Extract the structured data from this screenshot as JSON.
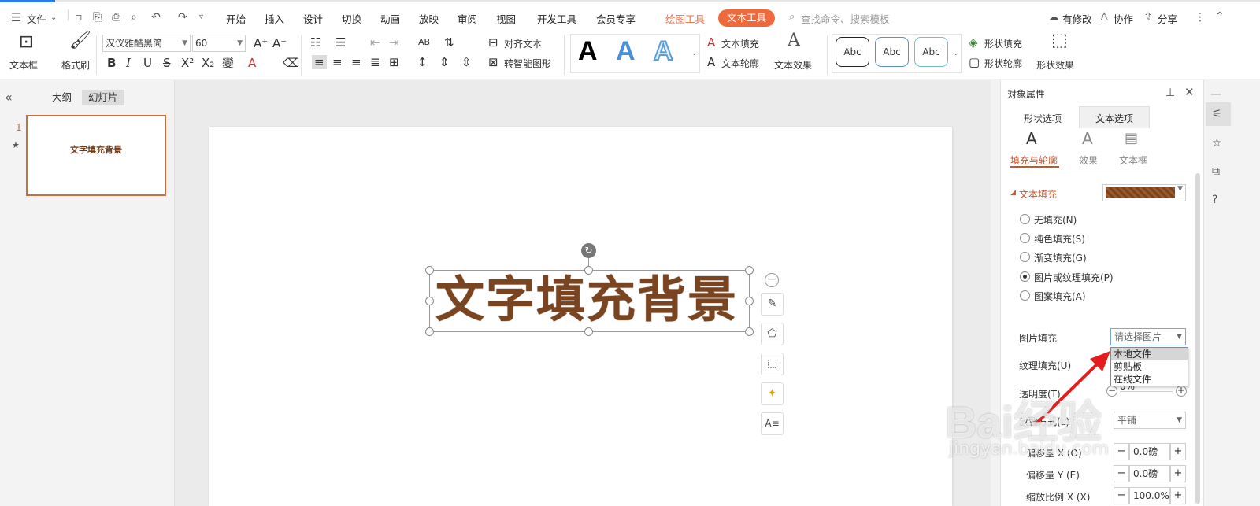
{
  "menubar": {
    "file": "文件",
    "tabs": [
      "开始",
      "插入",
      "设计",
      "切换",
      "动画",
      "放映",
      "审阅",
      "视图",
      "开发工具",
      "会员专享"
    ],
    "drawing_tools": "绘图工具",
    "text_tools": "文本工具",
    "search_placeholder": "查找命令、搜索模板",
    "has_changes": "有修改",
    "collaborate": "协作",
    "share": "分享"
  },
  "ribbon": {
    "textbox": "文本框",
    "format_painter": "格式刷",
    "font_name": "汉仪雅酷黑简",
    "font_size": "60",
    "align_text": "对齐文本",
    "smart_shape": "转智能图形",
    "text_fill": "文本填充",
    "text_outline": "文本轮廓",
    "text_effect": "文本效果",
    "style_sample": "Abc",
    "shape_fill": "形状填充",
    "shape_outline": "形状轮廓",
    "shape_effect": "形状效果",
    "bigA": "A"
  },
  "left_panel": {
    "outline_tab": "大纲",
    "slides_tab": "幻灯片",
    "slide_number": "1",
    "thumb_text": "文字填充背景"
  },
  "slide": {
    "main_text": "文字填充背景"
  },
  "right_panel": {
    "title": "对象属性",
    "tab_shape": "形状选项",
    "tab_text": "文本选项",
    "sub_fill": "填充与轮廓",
    "sub_effect": "效果",
    "sub_textbox": "文本框",
    "section_text_fill": "文本填充",
    "options": [
      "无填充(N)",
      "纯色填充(S)",
      "渐变填充(G)",
      "图片或纹理填充(P)",
      "图案填充(A)"
    ],
    "picture_fill_label": "图片填充",
    "picture_fill_value": "请选择图片",
    "dropdown_items": [
      "本地文件",
      "剪贴板",
      "在线文件"
    ],
    "texture_fill_label": "纹理填充(U)",
    "transparency_label": "透明度(T)",
    "transparency_value": "0%",
    "tile_label": "放置方式(L)",
    "tile_value": "平铺",
    "offset_x_label": "偏移量 X (O)",
    "offset_x_value": "0.0磅",
    "offset_y_label": "偏移量 Y (E)",
    "offset_y_value": "0.0磅",
    "scale_x_label": "缩放比例 X (X)",
    "scale_x_value": "100.0%"
  },
  "watermark": {
    "main": "Bai经验",
    "url": "jingyan.baidu.com"
  },
  "colors": {
    "accent_orange": "#ee6a3d",
    "text_brown": "#7a4420",
    "active_tab": "#c9562a"
  }
}
